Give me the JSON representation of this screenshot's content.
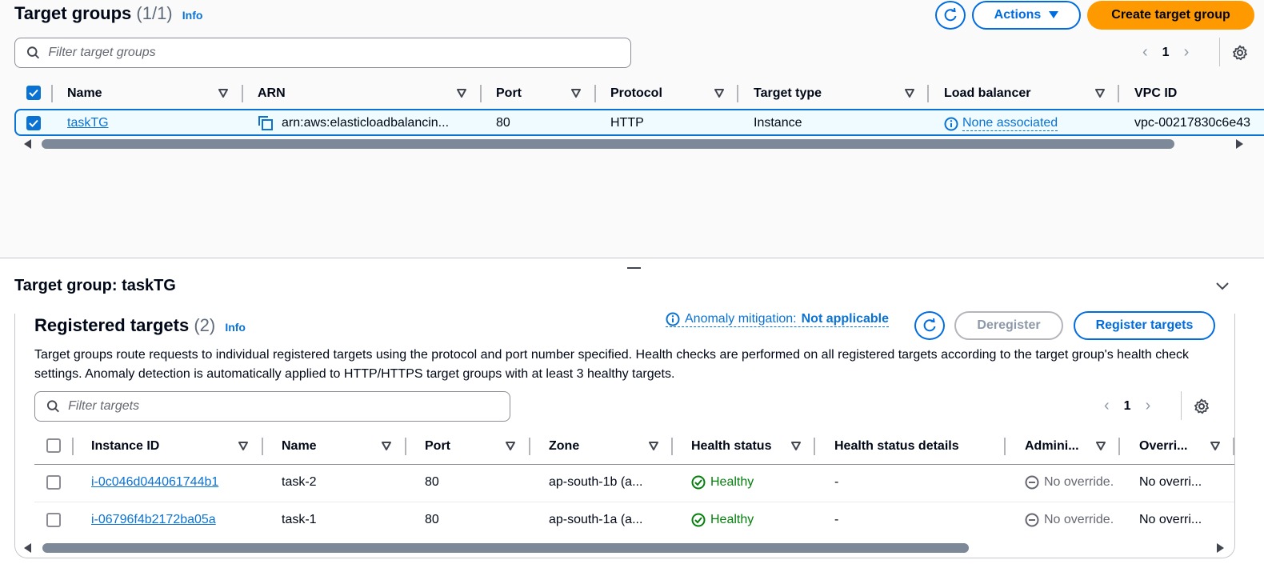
{
  "target_groups": {
    "title": "Target groups",
    "count": "(1/1)",
    "info": "Info",
    "actions_label": "Actions",
    "create_label": "Create target group",
    "search_placeholder": "Filter target groups",
    "page": "1",
    "columns": [
      "Name",
      "ARN",
      "Port",
      "Protocol",
      "Target type",
      "Load balancer",
      "VPC ID"
    ],
    "rows": [
      {
        "name": "taskTG",
        "arn": "arn:aws:elasticloadbalancin...",
        "port": "80",
        "protocol": "HTTP",
        "target_type": "Instance",
        "load_balancer": "None associated",
        "vpc_id": "vpc-00217830c6e43"
      }
    ]
  },
  "detail": {
    "title": "Target group: taskTG"
  },
  "registered_targets": {
    "title": "Registered targets",
    "count": "(2)",
    "info": "Info",
    "anomaly_label": "Anomaly mitigation:",
    "anomaly_value": "Not applicable",
    "deregister_label": "Deregister",
    "register_label": "Register targets",
    "description": "Target groups route requests to individual registered targets using the protocol and port number specified. Health checks are performed on all registered targets according to the target group's health check settings. Anomaly detection is automatically applied to HTTP/HTTPS target groups with at least 3 healthy targets.",
    "search_placeholder": "Filter targets",
    "page": "1",
    "columns": [
      "Instance ID",
      "Name",
      "Port",
      "Zone",
      "Health status",
      "Health status details",
      "Admini...",
      "Overri..."
    ],
    "rows": [
      {
        "instance_id": "i-0c046d044061744b1",
        "name": "task-2",
        "port": "80",
        "zone": "ap-south-1b (a...",
        "health": "Healthy",
        "details": "-",
        "admin": "No override.",
        "override": "No overri..."
      },
      {
        "instance_id": "i-06796f4b2172ba05a",
        "name": "task-1",
        "port": "80",
        "zone": "ap-south-1a (a...",
        "health": "Healthy",
        "details": "-",
        "admin": "No override.",
        "override": "No overri..."
      }
    ]
  },
  "colors": {
    "accent": "#0972d3",
    "primary_button": "#ff9900",
    "healthy": "#037f0c"
  }
}
